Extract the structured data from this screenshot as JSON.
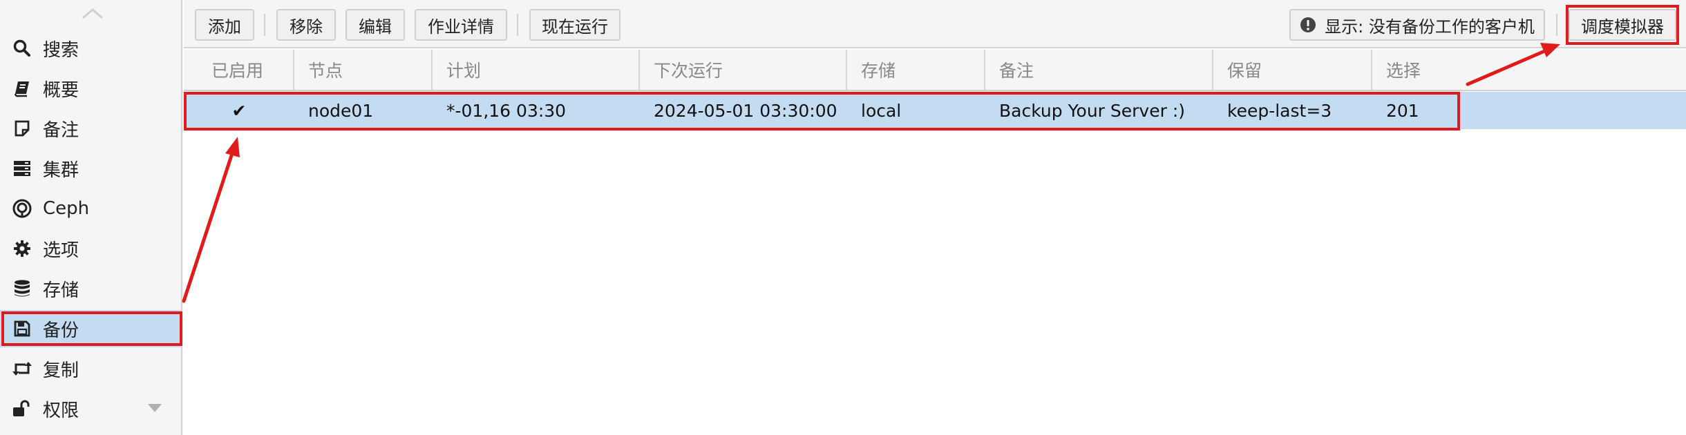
{
  "sidebar": {
    "items": [
      {
        "label": "搜索",
        "icon": "search-icon"
      },
      {
        "label": "概要",
        "icon": "book-icon"
      },
      {
        "label": "备注",
        "icon": "note-icon"
      },
      {
        "label": "集群",
        "icon": "server-icon"
      },
      {
        "label": "Ceph",
        "icon": "ceph-icon"
      },
      {
        "label": "选项",
        "icon": "gear-icon"
      },
      {
        "label": "存储",
        "icon": "database-icon"
      },
      {
        "label": "备份",
        "icon": "floppy-icon",
        "active": true
      },
      {
        "label": "复制",
        "icon": "retweet-icon"
      },
      {
        "label": "权限",
        "icon": "unlock-icon"
      }
    ]
  },
  "toolbar": {
    "add_label": "添加",
    "remove_label": "移除",
    "edit_label": "编辑",
    "job_detail_label": "作业详情",
    "run_now_label": "现在运行",
    "show_guests_label": "显示: 没有备份工作的客户机",
    "schedule_sim_label": "调度模拟器"
  },
  "grid": {
    "columns": [
      "已启用",
      "节点",
      "计划",
      "下次运行",
      "存储",
      "备注",
      "保留",
      "选择"
    ],
    "rows": [
      {
        "enabled": "✔",
        "node": "node01",
        "schedule": "*-01,16 03:30",
        "next_run": "2024-05-01 03:30:00",
        "storage": "local",
        "comment": "Backup Your Server :)",
        "retention": "keep-last=3",
        "selection": "201"
      }
    ]
  },
  "colors": {
    "selection": "#c3dcf2",
    "annotation": "#e11b1b",
    "toolbar_bg": "#f5f5f5"
  }
}
